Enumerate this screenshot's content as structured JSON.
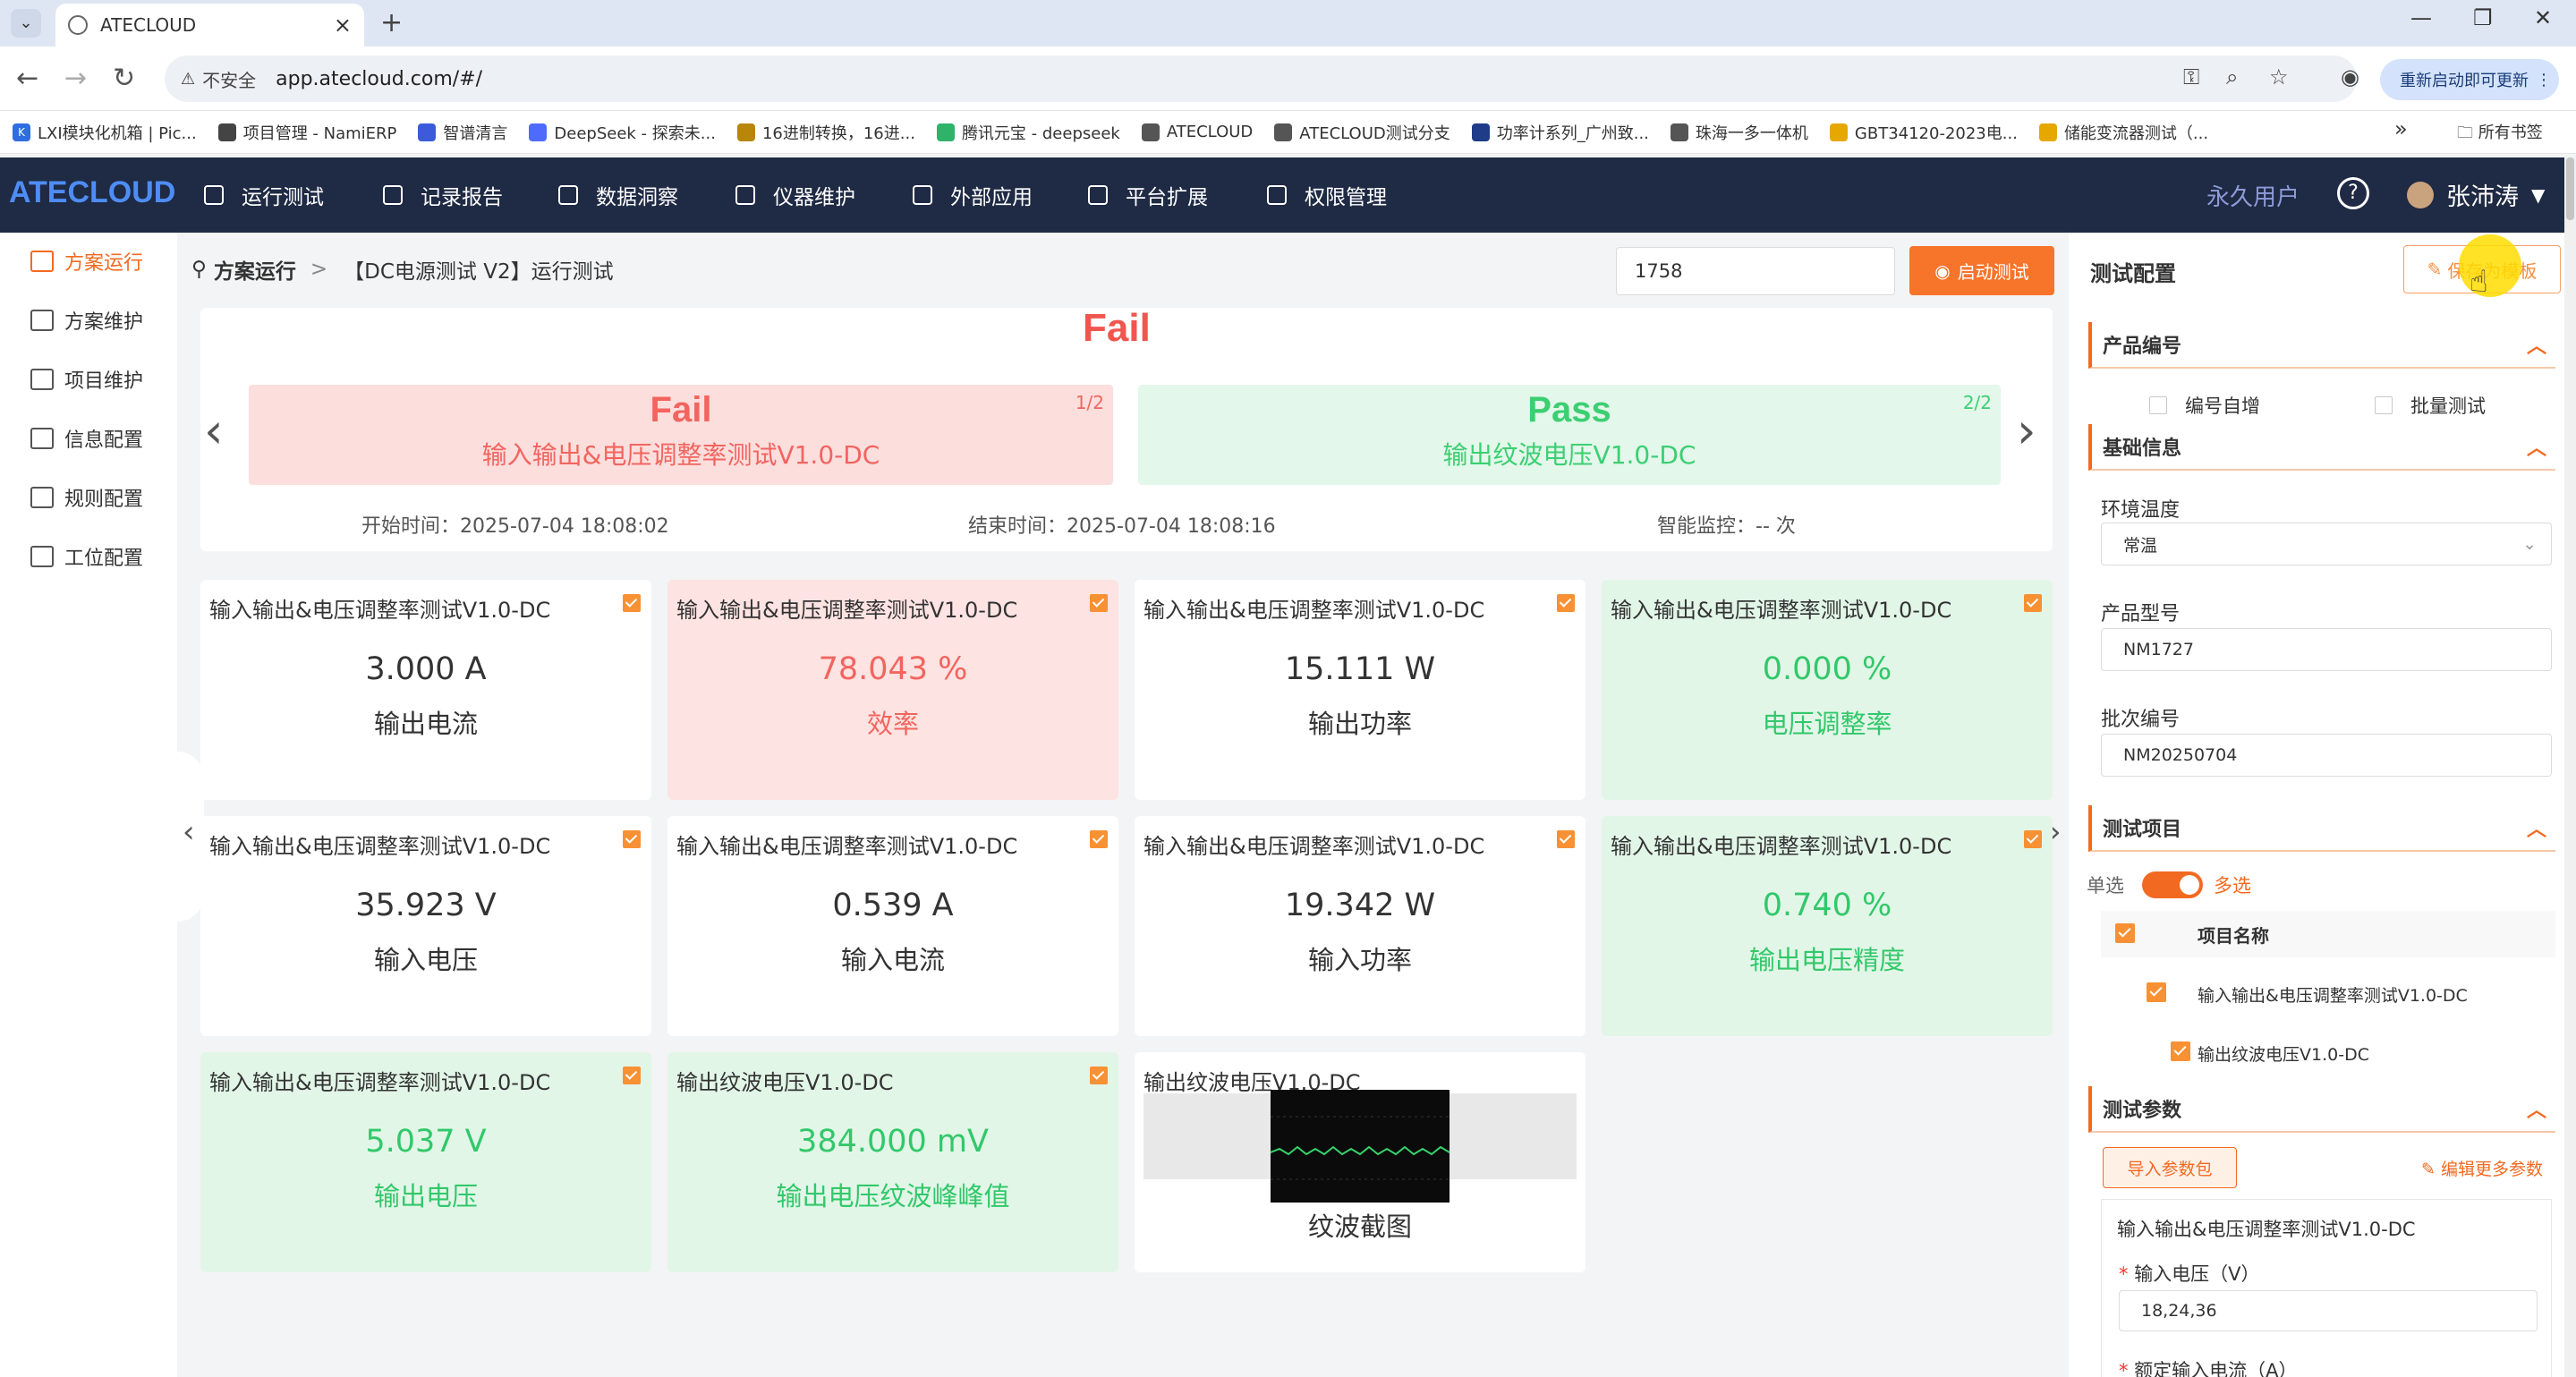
{
  "browser": {
    "tab_title": "ATECLOUD",
    "security_label": "不安全",
    "url": "app.atecloud.com/#/",
    "update_label": "重新启动即可更新",
    "bookmarks": [
      "LXI模块化机箱 | Pic...",
      "项目管理 - NamiERP",
      "智谱清言",
      "DeepSeek - 探索未...",
      "16进制转换，16进...",
      "腾讯元宝 - deepseek",
      "ATECLOUD",
      "ATECLOUD测试分支",
      "功率计系列_广州致...",
      "珠海一多一体机",
      "GBT34120-2023电...",
      "储能变流器测试（..."
    ],
    "all_bookmarks": "所有书签"
  },
  "app": {
    "logo": "ATECLOUD",
    "nav": [
      "运行测试",
      "记录报告",
      "数据洞察",
      "仪器维护",
      "外部应用",
      "平台扩展",
      "权限管理"
    ],
    "permanent_user": "永久用户",
    "help": "?",
    "username": "张沛涛"
  },
  "sidebar": {
    "items": [
      "方案运行",
      "方案维护",
      "项目维护",
      "信息配置",
      "规则配置",
      "工位配置"
    ]
  },
  "main": {
    "breadcrumb_root": "方案运行",
    "breadcrumb_sep": ">",
    "breadcrumb_page": "【DC电源测试 V2】运行测试",
    "sn_value": "1758",
    "start_button": "启动测试",
    "overall_result": "Fail",
    "results": [
      {
        "status": "Fail",
        "name": "输入输出&电压调整率测试V1.0-DC",
        "page": "1/2"
      },
      {
        "status": "Pass",
        "name": "输出纹波电压V1.0-DC",
        "page": "2/2"
      }
    ],
    "start_time_label": "开始时间：",
    "start_time": "2025-07-04 18:08:02",
    "end_time_label": "结束时间：",
    "end_time": "2025-07-04 18:08:16",
    "monitor_label": "智能监控：",
    "monitor_value": "-- 次",
    "cards": [
      {
        "title": "输入输出&电压调整率测试V1.0-DC",
        "value": "3.000   A",
        "label": "输出电流",
        "state": "normal"
      },
      {
        "title": "输入输出&电压调整率测试V1.0-DC",
        "value": "78.043   %",
        "label": "效率",
        "state": "red"
      },
      {
        "title": "输入输出&电压调整率测试V1.0-DC",
        "value": "15.111   W",
        "label": "输出功率",
        "state": "normal"
      },
      {
        "title": "输入输出&电压调整率测试V1.0-DC",
        "value": "0.000   %",
        "label": "电压调整率",
        "state": "green"
      },
      {
        "title": "输入输出&电压调整率测试V1.0-DC",
        "value": "35.923   V",
        "label": "输入电压",
        "state": "normal"
      },
      {
        "title": "输入输出&电压调整率测试V1.0-DC",
        "value": "0.539   A",
        "label": "输入电流",
        "state": "normal"
      },
      {
        "title": "输入输出&电压调整率测试V1.0-DC",
        "value": "19.342   W",
        "label": "输入功率",
        "state": "normal"
      },
      {
        "title": "输入输出&电压调整率测试V1.0-DC",
        "value": "0.740   %",
        "label": "输出电压精度",
        "state": "green"
      },
      {
        "title": "输入输出&电压调整率测试V1.0-DC",
        "value": "5.037   V",
        "label": "输出电压",
        "state": "green"
      },
      {
        "title": "输出纹波电压V1.0-DC",
        "value": "384.000   mV",
        "label": "输出电压纹波峰峰值",
        "state": "green"
      },
      {
        "title": "输出纹波电压V1.0-DC",
        "value": "",
        "label": "纹波截图",
        "state": "image"
      }
    ]
  },
  "config": {
    "title": "测试配置",
    "save_template": "保存为模板",
    "product_sn_section": "产品编号",
    "auto_increment": "编号自增",
    "batch_test": "批量测试",
    "basic_info_section": "基础信息",
    "env_temp_label": "环境温度",
    "env_temp_value": "常温",
    "model_label": "产品型号",
    "model_value": "NM1727",
    "batch_label": "批次编号",
    "batch_value": "NM20250704",
    "test_items_section": "测试项目",
    "single": "单选",
    "multi": "多选",
    "col_name": "项目名称",
    "items": [
      "输入输出&电压调整率测试V1.0-DC",
      "输出纹波电压V1.0-DC"
    ],
    "params_section": "测试参数",
    "import_button": "导入参数包",
    "edit_more": "编辑更多参数",
    "param_group": "输入输出&电压调整率测试V1.0-DC",
    "param_label": "输入电压（V）",
    "param_value": "18,24,36",
    "param_label_2": "额定输入电流（A）"
  },
  "colors": {
    "accent": "#f26a21",
    "fail": "#f2655f",
    "pass": "#32c86a",
    "header": "#1f2a44"
  }
}
